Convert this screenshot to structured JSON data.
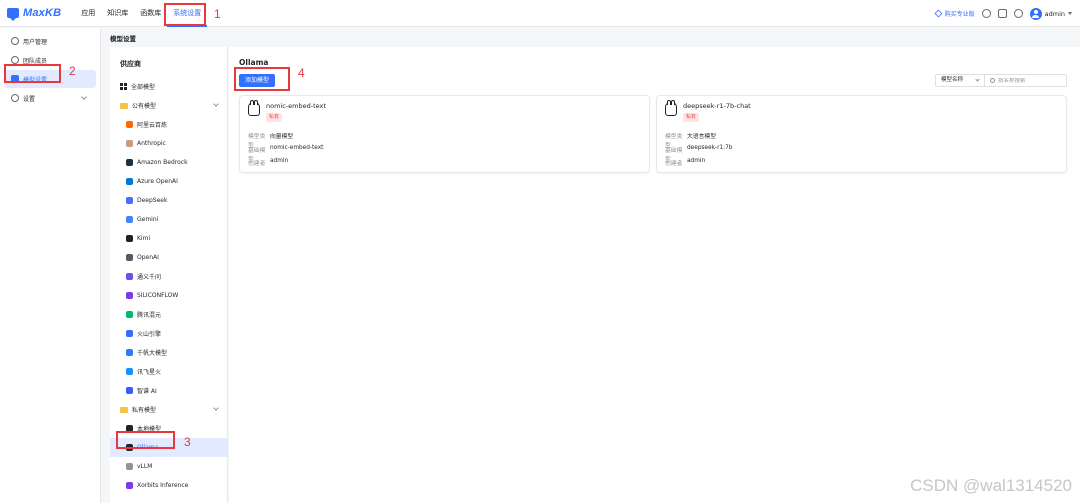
{
  "app": {
    "name": "MaxKB"
  },
  "nav": [
    {
      "label": "应用",
      "active": false
    },
    {
      "label": "知识库",
      "active": false
    },
    {
      "label": "函数库",
      "active": false
    },
    {
      "label": "系统设置",
      "active": true
    }
  ],
  "topbar": {
    "pro_label": "购买专业版",
    "user": "admin"
  },
  "sidebar": {
    "items": [
      {
        "label": "用户管理",
        "icon": "user-icon",
        "active": false
      },
      {
        "label": "团队成员",
        "icon": "team-icon",
        "active": false
      },
      {
        "label": "模型设置",
        "icon": "model-icon",
        "active": true
      },
      {
        "label": "设置",
        "icon": "settings-icon",
        "active": false,
        "expandable": true
      }
    ]
  },
  "page_title": "模型设置",
  "provider": {
    "title": "供应商",
    "all_models": "全部模型",
    "public_group": "公有模型",
    "public_items": [
      {
        "label": "阿里云百炼",
        "color": "#ff6a00"
      },
      {
        "label": "Anthropic",
        "color": "#cc9b7a"
      },
      {
        "label": "Amazon Bedrock",
        "color": "#232f3e"
      },
      {
        "label": "Azure OpenAI",
        "color": "#0078d4"
      },
      {
        "label": "DeepSeek",
        "color": "#4d6bfe"
      },
      {
        "label": "Gemini",
        "color": "#4285f4"
      },
      {
        "label": "Kimi",
        "color": "#1f2329"
      },
      {
        "label": "OpenAI",
        "color": "#555b63"
      },
      {
        "label": "通义千问",
        "color": "#6f4cf5"
      },
      {
        "label": "SILICONFLOW",
        "color": "#7c3aed"
      },
      {
        "label": "腾讯混元",
        "color": "#00b96b"
      },
      {
        "label": "火山引擎",
        "color": "#3370ff"
      },
      {
        "label": "千帆大模型",
        "color": "#2e7df6"
      },
      {
        "label": "讯飞星火",
        "color": "#1890ff"
      },
      {
        "label": "智谱 AI",
        "color": "#3d5afe"
      }
    ],
    "private_group": "私有模型",
    "private_items": [
      {
        "label": "本地模型",
        "color": "#1f2329",
        "active": false
      },
      {
        "label": "Ollama",
        "color": "#1f2329",
        "active": true
      },
      {
        "label": "vLLM",
        "color": "#8f959e",
        "active": false
      },
      {
        "label": "Xorbits Inference",
        "color": "#7c3aed",
        "active": false
      }
    ]
  },
  "main": {
    "title": "Ollama",
    "add_button": "添加模型",
    "filter_select": "模型名称",
    "search_placeholder": "按名称搜索",
    "cards": [
      {
        "name": "nomic-embed-text",
        "badge": "私有",
        "rows": [
          {
            "k": "模型类型",
            "v": "向量模型"
          },
          {
            "k": "基础模型",
            "v": "nomic-embed-text"
          },
          {
            "k": "创建者",
            "v": "admin"
          }
        ]
      },
      {
        "name": "deepseek-r1-7b-chat",
        "badge": "私有",
        "rows": [
          {
            "k": "模型类型",
            "v": "大语言模型"
          },
          {
            "k": "基础模型",
            "v": "deepseek-r1:7b"
          },
          {
            "k": "创建者",
            "v": "admin"
          }
        ]
      }
    ]
  },
  "annotations": [
    "1",
    "2",
    "3",
    "4"
  ],
  "watermark": "CSDN @wal1314520",
  "colors": {
    "accent": "#3370ff",
    "annotation": "#e8383d",
    "badge": "#f54a45"
  }
}
